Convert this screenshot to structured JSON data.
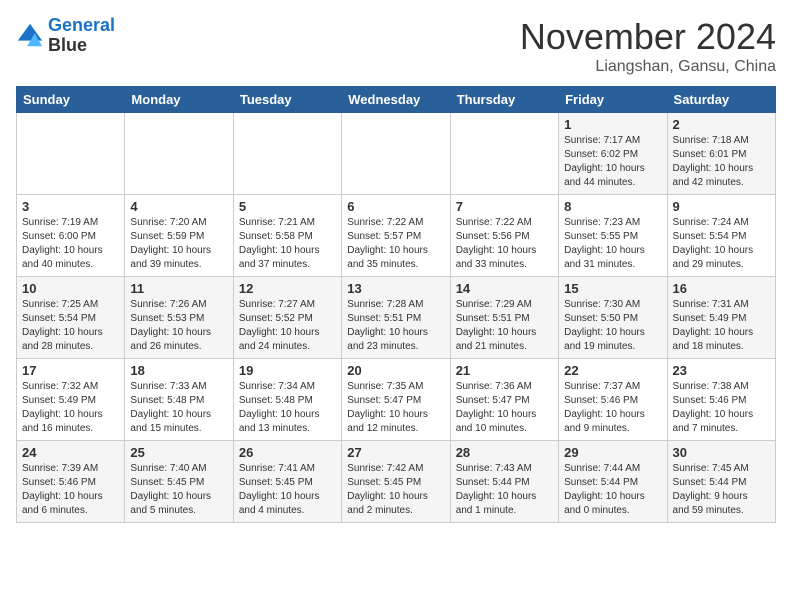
{
  "header": {
    "logo_line1": "General",
    "logo_line2": "Blue",
    "month": "November 2024",
    "location": "Liangshan, Gansu, China"
  },
  "weekdays": [
    "Sunday",
    "Monday",
    "Tuesday",
    "Wednesday",
    "Thursday",
    "Friday",
    "Saturday"
  ],
  "weeks": [
    [
      {
        "day": "",
        "info": ""
      },
      {
        "day": "",
        "info": ""
      },
      {
        "day": "",
        "info": ""
      },
      {
        "day": "",
        "info": ""
      },
      {
        "day": "",
        "info": ""
      },
      {
        "day": "1",
        "info": "Sunrise: 7:17 AM\nSunset: 6:02 PM\nDaylight: 10 hours\nand 44 minutes."
      },
      {
        "day": "2",
        "info": "Sunrise: 7:18 AM\nSunset: 6:01 PM\nDaylight: 10 hours\nand 42 minutes."
      }
    ],
    [
      {
        "day": "3",
        "info": "Sunrise: 7:19 AM\nSunset: 6:00 PM\nDaylight: 10 hours\nand 40 minutes."
      },
      {
        "day": "4",
        "info": "Sunrise: 7:20 AM\nSunset: 5:59 PM\nDaylight: 10 hours\nand 39 minutes."
      },
      {
        "day": "5",
        "info": "Sunrise: 7:21 AM\nSunset: 5:58 PM\nDaylight: 10 hours\nand 37 minutes."
      },
      {
        "day": "6",
        "info": "Sunrise: 7:22 AM\nSunset: 5:57 PM\nDaylight: 10 hours\nand 35 minutes."
      },
      {
        "day": "7",
        "info": "Sunrise: 7:22 AM\nSunset: 5:56 PM\nDaylight: 10 hours\nand 33 minutes."
      },
      {
        "day": "8",
        "info": "Sunrise: 7:23 AM\nSunset: 5:55 PM\nDaylight: 10 hours\nand 31 minutes."
      },
      {
        "day": "9",
        "info": "Sunrise: 7:24 AM\nSunset: 5:54 PM\nDaylight: 10 hours\nand 29 minutes."
      }
    ],
    [
      {
        "day": "10",
        "info": "Sunrise: 7:25 AM\nSunset: 5:54 PM\nDaylight: 10 hours\nand 28 minutes."
      },
      {
        "day": "11",
        "info": "Sunrise: 7:26 AM\nSunset: 5:53 PM\nDaylight: 10 hours\nand 26 minutes."
      },
      {
        "day": "12",
        "info": "Sunrise: 7:27 AM\nSunset: 5:52 PM\nDaylight: 10 hours\nand 24 minutes."
      },
      {
        "day": "13",
        "info": "Sunrise: 7:28 AM\nSunset: 5:51 PM\nDaylight: 10 hours\nand 23 minutes."
      },
      {
        "day": "14",
        "info": "Sunrise: 7:29 AM\nSunset: 5:51 PM\nDaylight: 10 hours\nand 21 minutes."
      },
      {
        "day": "15",
        "info": "Sunrise: 7:30 AM\nSunset: 5:50 PM\nDaylight: 10 hours\nand 19 minutes."
      },
      {
        "day": "16",
        "info": "Sunrise: 7:31 AM\nSunset: 5:49 PM\nDaylight: 10 hours\nand 18 minutes."
      }
    ],
    [
      {
        "day": "17",
        "info": "Sunrise: 7:32 AM\nSunset: 5:49 PM\nDaylight: 10 hours\nand 16 minutes."
      },
      {
        "day": "18",
        "info": "Sunrise: 7:33 AM\nSunset: 5:48 PM\nDaylight: 10 hours\nand 15 minutes."
      },
      {
        "day": "19",
        "info": "Sunrise: 7:34 AM\nSunset: 5:48 PM\nDaylight: 10 hours\nand 13 minutes."
      },
      {
        "day": "20",
        "info": "Sunrise: 7:35 AM\nSunset: 5:47 PM\nDaylight: 10 hours\nand 12 minutes."
      },
      {
        "day": "21",
        "info": "Sunrise: 7:36 AM\nSunset: 5:47 PM\nDaylight: 10 hours\nand 10 minutes."
      },
      {
        "day": "22",
        "info": "Sunrise: 7:37 AM\nSunset: 5:46 PM\nDaylight: 10 hours\nand 9 minutes."
      },
      {
        "day": "23",
        "info": "Sunrise: 7:38 AM\nSunset: 5:46 PM\nDaylight: 10 hours\nand 7 minutes."
      }
    ],
    [
      {
        "day": "24",
        "info": "Sunrise: 7:39 AM\nSunset: 5:46 PM\nDaylight: 10 hours\nand 6 minutes."
      },
      {
        "day": "25",
        "info": "Sunrise: 7:40 AM\nSunset: 5:45 PM\nDaylight: 10 hours\nand 5 minutes."
      },
      {
        "day": "26",
        "info": "Sunrise: 7:41 AM\nSunset: 5:45 PM\nDaylight: 10 hours\nand 4 minutes."
      },
      {
        "day": "27",
        "info": "Sunrise: 7:42 AM\nSunset: 5:45 PM\nDaylight: 10 hours\nand 2 minutes."
      },
      {
        "day": "28",
        "info": "Sunrise: 7:43 AM\nSunset: 5:44 PM\nDaylight: 10 hours\nand 1 minute."
      },
      {
        "day": "29",
        "info": "Sunrise: 7:44 AM\nSunset: 5:44 PM\nDaylight: 10 hours\nand 0 minutes."
      },
      {
        "day": "30",
        "info": "Sunrise: 7:45 AM\nSunset: 5:44 PM\nDaylight: 9 hours\nand 59 minutes."
      }
    ]
  ]
}
